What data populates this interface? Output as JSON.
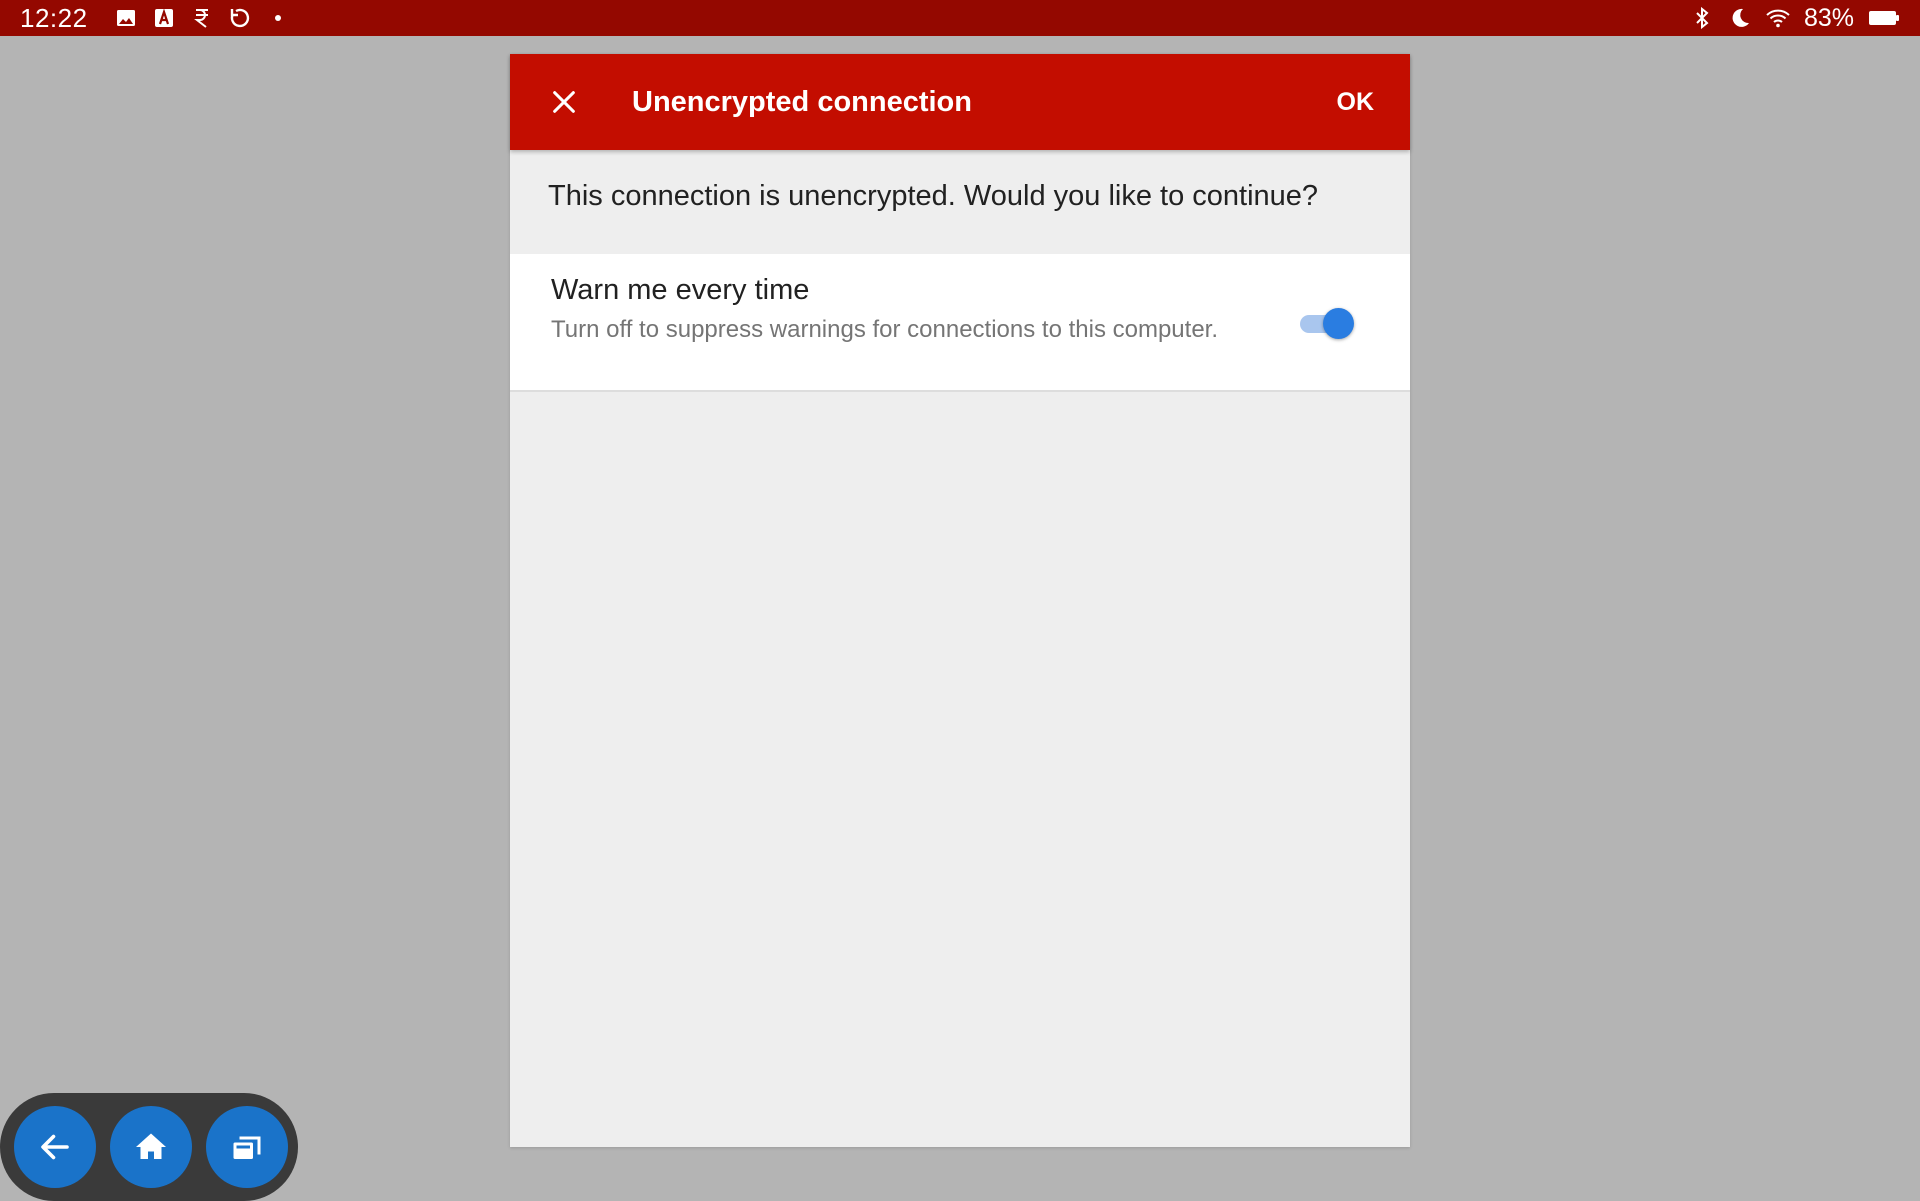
{
  "status_bar": {
    "time": "12:22",
    "left_icons": [
      "image-icon",
      "text-a-icon",
      "rupee-icon",
      "sync-icon",
      "dot-icon"
    ],
    "right_icons": [
      "bluetooth-icon",
      "moon-icon",
      "wifi-icon",
      "battery-icon"
    ],
    "battery_percent": "83%"
  },
  "dialog": {
    "title": "Unencrypted connection",
    "close_icon": "close-icon",
    "ok_label": "OK",
    "message": "This connection is unencrypted. Would you like to continue?",
    "setting": {
      "title": "Warn me every time",
      "summary": "Turn off to suppress warnings for connections to this computer.",
      "enabled": true
    }
  },
  "nav": {
    "buttons": [
      "back-arrow-icon",
      "home-icon",
      "recent-apps-icon"
    ]
  },
  "colors": {
    "status_bar": "#940800",
    "header": "#c30d00",
    "accent": "#2a7de1",
    "background": "#b4b4b4"
  }
}
